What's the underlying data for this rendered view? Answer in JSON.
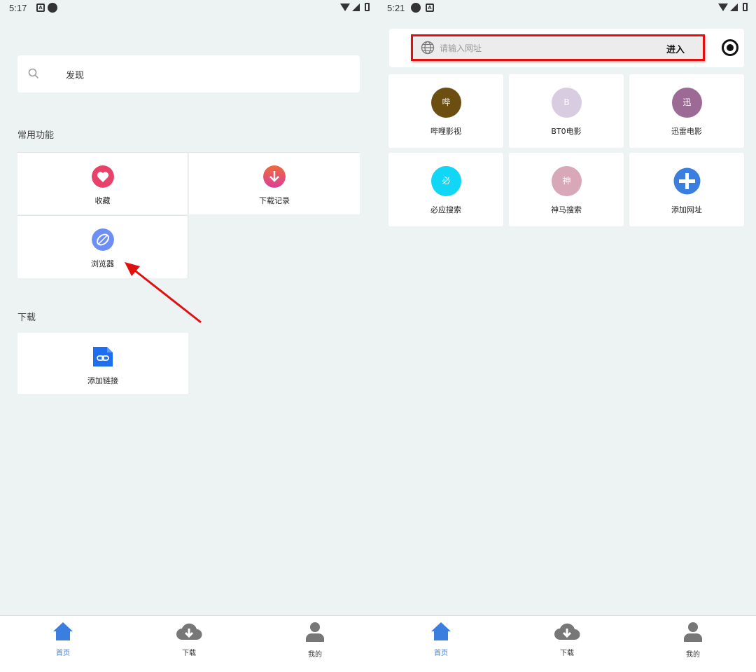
{
  "left": {
    "status": {
      "time": "5:17"
    },
    "search": {
      "text": "发现"
    },
    "sections": {
      "common": "常用功能",
      "download": "下载"
    },
    "common_items": [
      {
        "label": "收藏",
        "icon": "heart-icon",
        "color": "#e8416a"
      },
      {
        "label": "下载记录",
        "icon": "download-arrow-icon",
        "color": "#e8457a"
      },
      {
        "label": "浏览器",
        "icon": "leaf-browser-icon",
        "color": "#6c8ef5"
      }
    ],
    "download_items": [
      {
        "label": "添加链接",
        "icon": "link-file-icon",
        "color": "#1e6ff0"
      }
    ],
    "nav": [
      {
        "label": "首页",
        "icon": "home-icon",
        "active": true
      },
      {
        "label": "下载",
        "icon": "cloud-download-icon",
        "active": false
      },
      {
        "label": "我的",
        "icon": "person-icon",
        "active": false
      }
    ]
  },
  "right": {
    "status": {
      "time": "5:21"
    },
    "url_bar": {
      "placeholder": "请输入网址",
      "go_label": "进入"
    },
    "sites": [
      {
        "letter": "哔",
        "label": "哔哩影视",
        "color": "#6b4e10"
      },
      {
        "letter": "B",
        "label": "BT0电影",
        "color": "#d8cce0"
      },
      {
        "letter": "迅",
        "label": "迅雷电影",
        "color": "#9c6a94"
      },
      {
        "letter": "必",
        "label": "必应搜索",
        "color": "#12d6f5"
      },
      {
        "letter": "神",
        "label": "神马搜索",
        "color": "#d9a8b8"
      },
      {
        "letter": "+",
        "label": "添加网址",
        "color": "#3a7fe0"
      }
    ],
    "nav": [
      {
        "label": "首页",
        "icon": "home-icon",
        "active": true
      },
      {
        "label": "下载",
        "icon": "cloud-download-icon",
        "active": false
      },
      {
        "label": "我的",
        "icon": "person-icon",
        "active": false
      }
    ]
  },
  "colors": {
    "background": "#edf2f2",
    "accent": "#3a7fe0",
    "highlight": "#e01010"
  }
}
